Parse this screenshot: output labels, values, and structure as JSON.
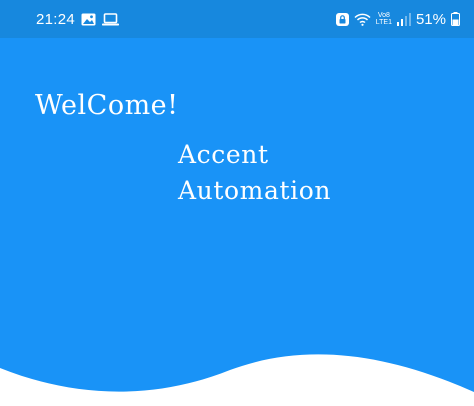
{
  "status_bar": {
    "time": "21:24",
    "network_label_top": "Vo8",
    "network_label_bottom": "LTE1",
    "battery_percent": "51%",
    "signal_level": 0.6,
    "icons": [
      "image-icon",
      "laptop-icon",
      "app-lock-icon",
      "wifi-icon",
      "signal-icon",
      "battery-icon"
    ]
  },
  "hero": {
    "welcome_text": "WelCome!",
    "brand_line_1": "Accent",
    "brand_line_2": "Automation"
  },
  "colors": {
    "status_bar": "#1788de",
    "hero": "#1993f7",
    "text": "#ffffff",
    "wave": "#ffffff"
  }
}
